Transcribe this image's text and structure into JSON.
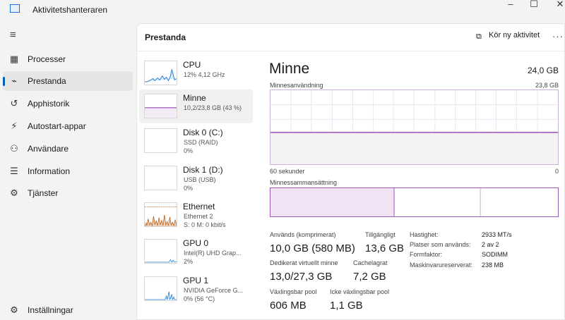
{
  "window": {
    "title": "Aktivitetshanteraren",
    "minimize": "–",
    "maximize": "☐",
    "close": "✕"
  },
  "nav": {
    "menu_icon": "hamburger-icon",
    "items": [
      {
        "label": "Processer",
        "icon": "processes-icon",
        "glyph": "▦"
      },
      {
        "label": "Prestanda",
        "icon": "performance-icon",
        "glyph": "⌁"
      },
      {
        "label": "Apphistorik",
        "icon": "history-icon",
        "glyph": "↺"
      },
      {
        "label": "Autostart-appar",
        "icon": "startup-icon",
        "glyph": "⚡"
      },
      {
        "label": "Användare",
        "icon": "users-icon",
        "glyph": "⚇"
      },
      {
        "label": "Information",
        "icon": "details-icon",
        "glyph": "☰"
      },
      {
        "label": "Tjänster",
        "icon": "services-icon",
        "glyph": "⚙"
      }
    ],
    "settings": {
      "label": "Inställningar",
      "icon": "settings-icon",
      "glyph": "⚙"
    }
  },
  "header": {
    "title": "Prestanda",
    "run_task": "Kör ny aktivitet",
    "more": "···"
  },
  "devices": [
    {
      "name": "CPU",
      "sub1": "12% 4,12 GHz",
      "sub2": "",
      "sub3": "",
      "color": "#1f7fd6"
    },
    {
      "name": "Minne",
      "sub1": "10,2/23,8 GB (43 %)",
      "sub2": "",
      "sub3": "",
      "color": "#8b2fa8"
    },
    {
      "name": "Disk 0 (C:)",
      "sub1": "SSD (RAID)",
      "sub2": "0%",
      "sub3": "",
      "color": "#4a9a2a"
    },
    {
      "name": "Disk 1 (D:)",
      "sub1": "USB (USB)",
      "sub2": "0%",
      "sub3": "",
      "color": "#4a9a2a"
    },
    {
      "name": "Ethernet",
      "sub1": "Ethernet 2",
      "sub2": "S: 0 M: 0 kbit/s",
      "sub3": "",
      "color": "#b85c14"
    },
    {
      "name": "GPU 0",
      "sub1": "Intel(R) UHD Grap...",
      "sub2": "2%",
      "sub3": "",
      "color": "#1f7fd6"
    },
    {
      "name": "GPU 1",
      "sub1": "NVIDIA GeForce G...",
      "sub2": "0%  (56 °C)",
      "sub3": "",
      "color": "#1f7fd6"
    }
  ],
  "detail": {
    "title": "Minne",
    "total": "24,0 GB",
    "usage_label": "Minnesanvändning",
    "usage_max": "23,8 GB",
    "graph_left": "60 sekunder",
    "graph_right": "0",
    "composition_label": "Minnessammansättning",
    "usage_fraction": 0.43,
    "composition": {
      "in_use_fraction": 0.43,
      "modified_fraction": 0.0,
      "standby_fraction": 0.3
    },
    "stats": {
      "in_use_label": "Används (komprimerat)",
      "in_use_value": "10,0 GB (580 MB)",
      "available_label": "Tillgängligt",
      "available_value": "13,6 GB",
      "committed_label": "Dedikerat virtuellt minne",
      "committed_value": "13,0/27,3 GB",
      "cached_label": "Cachelagrat",
      "cached_value": "7,2 GB",
      "paged_label": "Växlingsbar pool",
      "paged_value": "606 MB",
      "nonpaged_label": "Icke växlingsbar pool",
      "nonpaged_value": "1,1 GB"
    },
    "specs": [
      {
        "key": "Hastighet:",
        "value": "2933 MT/s"
      },
      {
        "key": "Platser som används:",
        "value": "2 av 2"
      },
      {
        "key": "Formfaktor:",
        "value": "SODIMM"
      },
      {
        "key": "Maskinvarureserverat:",
        "value": "238 MB"
      }
    ]
  },
  "colors": {
    "memory": "#8b2fa8",
    "accent": "#005fb8"
  }
}
